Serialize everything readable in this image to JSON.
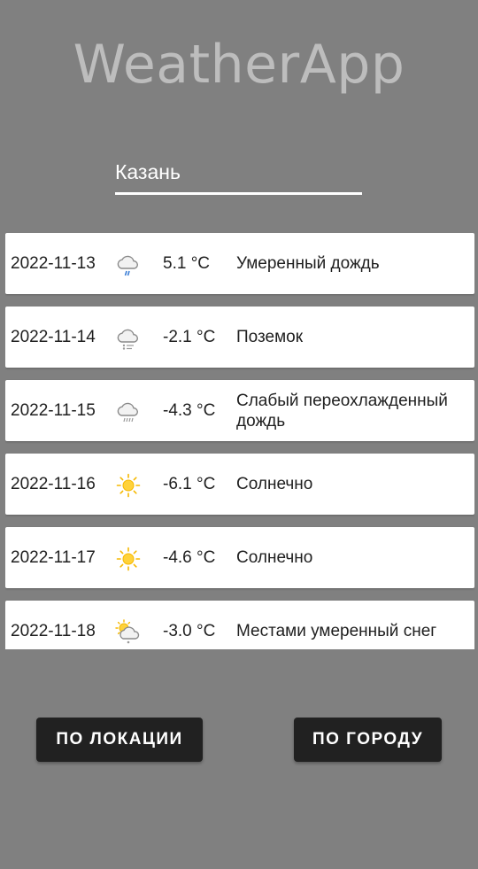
{
  "app": {
    "title": "WeatherApp"
  },
  "search": {
    "value": "Казань"
  },
  "forecast": [
    {
      "date": "2022-11-13",
      "icon": "cloud-rain-icon",
      "temp": "5.1 °C",
      "desc": "Умеренный дождь"
    },
    {
      "date": "2022-11-14",
      "icon": "cloud-drifting-snow-icon",
      "temp": "-2.1 °C",
      "desc": "Поземок"
    },
    {
      "date": "2022-11-15",
      "icon": "cloud-freezing-drizzle-icon",
      "temp": "-4.3 °C",
      "desc": "Слабый переохлажденный дождь"
    },
    {
      "date": "2022-11-16",
      "icon": "sun-icon",
      "temp": "-6.1 °C",
      "desc": "Солнечно"
    },
    {
      "date": "2022-11-17",
      "icon": "sun-icon",
      "temp": "-4.6 °C",
      "desc": "Солнечно"
    },
    {
      "date": "2022-11-18",
      "icon": "sun-cloud-snow-icon",
      "temp": "-3.0 °C",
      "desc": "Местами умеренный снег"
    }
  ],
  "buttons": {
    "by_location": "ПО ЛОКАЦИИ",
    "by_city": "ПО ГОРОДУ"
  },
  "colors": {
    "background": "#808080",
    "button": "#212121",
    "title": "#bdbdbd",
    "sun": "#f5b800",
    "rain": "#3d7fd6"
  }
}
